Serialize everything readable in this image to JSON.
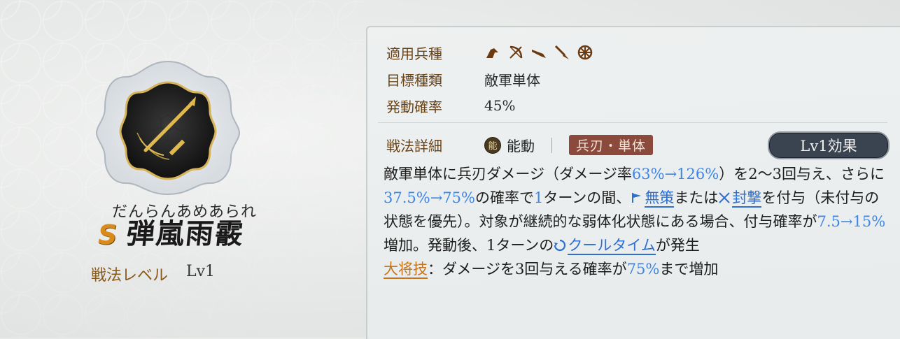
{
  "skill": {
    "ruby": "だんらんあめあられ",
    "rank": "S",
    "name": "弾嵐雨霰",
    "level_label": "戦法レベル",
    "level_value": "Lv1"
  },
  "info": {
    "troop_label": "適用兵種",
    "troop_icons": [
      "cavalry-icon",
      "bow-icon",
      "gun-icon",
      "spear-icon",
      "siege-wheel-icon"
    ],
    "target_label": "目標種類",
    "target_value": "敵軍単体",
    "rate_label": "発動確率",
    "rate_value": "45%"
  },
  "detail": {
    "label": "戦法詳細",
    "ability_icon_char": "能",
    "ability_text": "能動",
    "tag": "兵刃・単体",
    "effect_button": "Lv1効果"
  },
  "description": {
    "p1": "敵軍単体に兵刃ダメージ（ダメージ率",
    "v1": "63%→126%",
    "p2": "）を2〜3回与え、さらに",
    "v2": "37.5%→75%",
    "p3": "の確率で",
    "v3": "1",
    "p4": "ターンの間、",
    "kw1": "無策",
    "p5": "または",
    "kw2": "封撃",
    "p6": "を付与（未付与の状態を優先）。対象が継続的な弱体化状態にある場合、付与確率が",
    "v4": "7.5→15%",
    "p7": "増加。発動後、1ターンの",
    "kw3": "クールタイム",
    "p8": "が発生"
  },
  "commander": {
    "label": "大将技",
    "p1": "：ダメージを3回与える確率が",
    "v1": "75%",
    "p2": "まで増加"
  },
  "colors": {
    "accent_blue": "#3b86e8",
    "label_brown": "#6b4214",
    "rank_orange": "#d88b1a",
    "tag_red": "#8b4a3c"
  }
}
